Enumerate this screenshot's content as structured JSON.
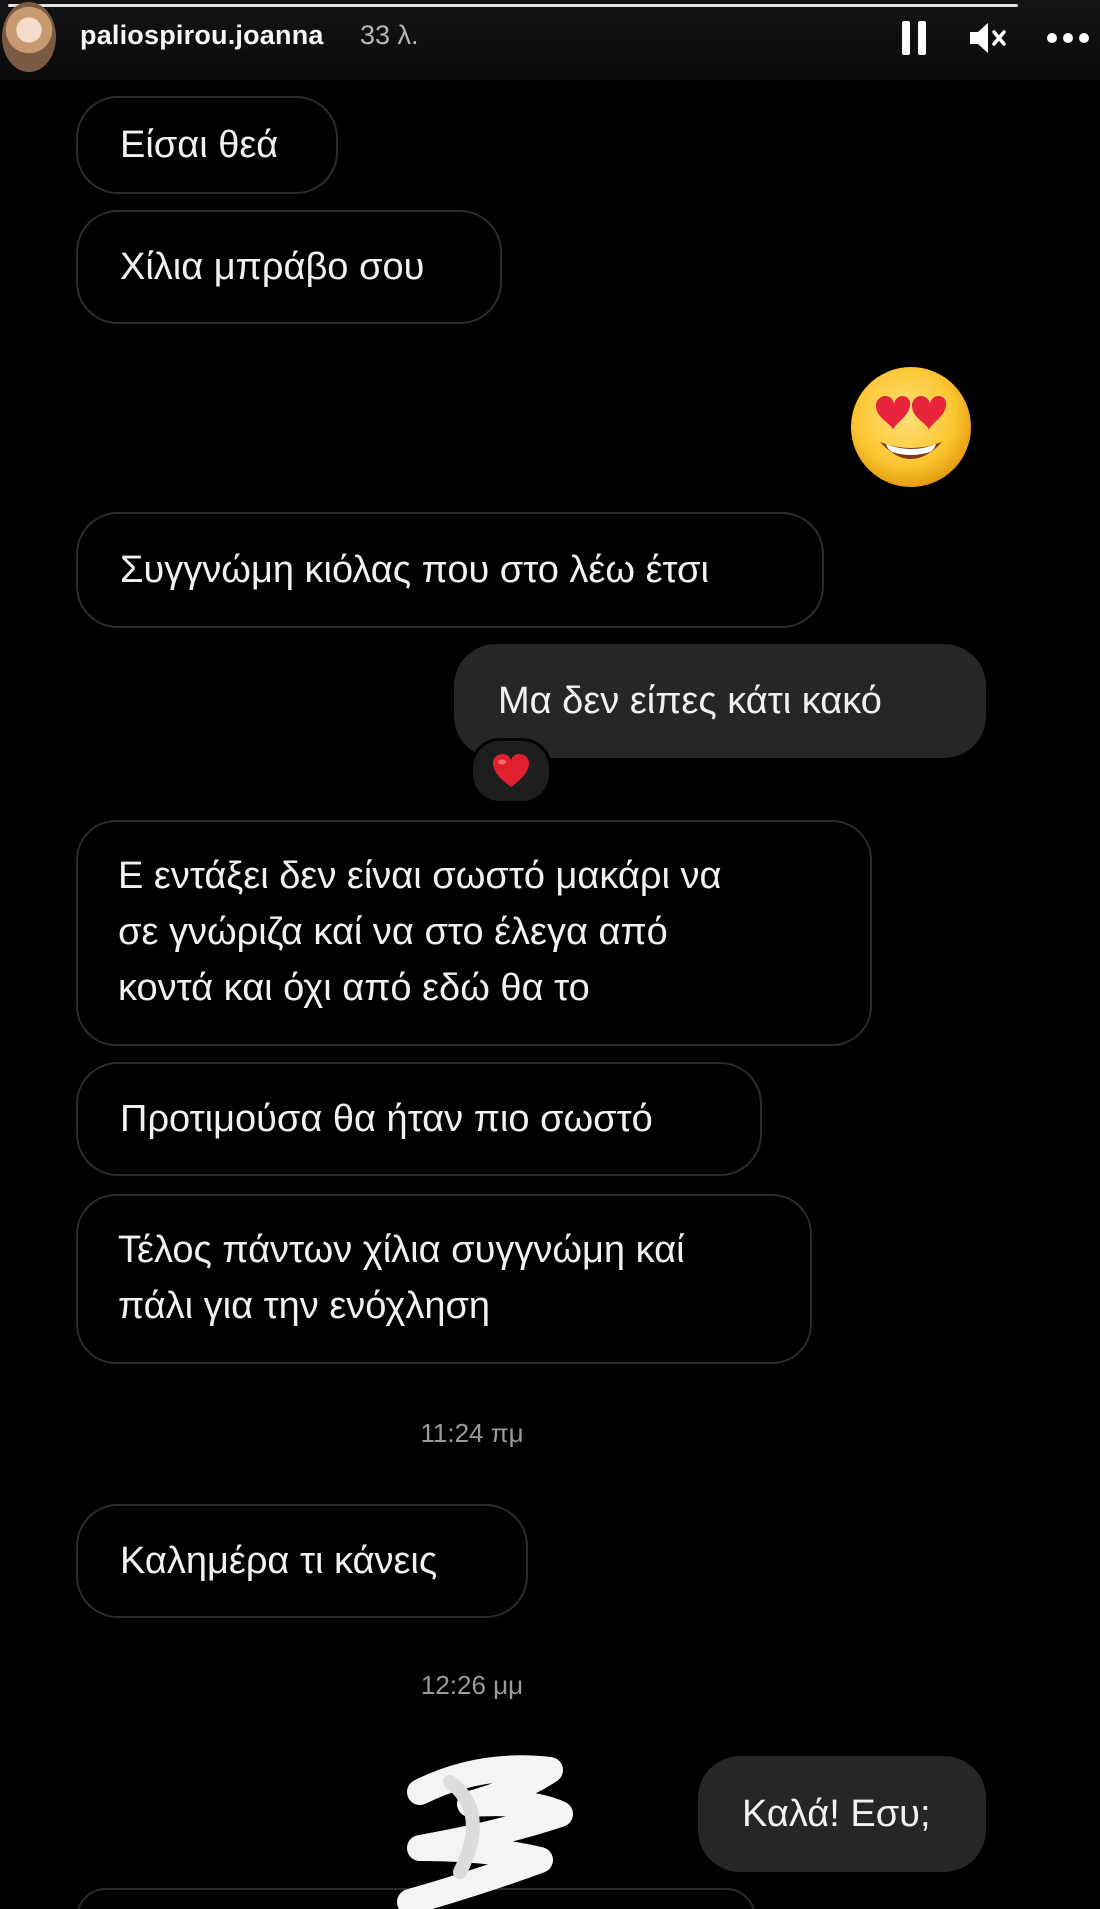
{
  "header": {
    "username": "paliospirou.joanna",
    "time_ago": "33 λ.",
    "avatar_icon": "profile-avatar",
    "pause_icon": "pause-icon",
    "mute_icon": "speaker-muted-icon",
    "more_icon": "more-dots-icon",
    "progress": 1.0
  },
  "messages": [
    {
      "side": "incoming",
      "text": "Είσαι θεά"
    },
    {
      "side": "incoming",
      "text": "Χίλια μπράβο σου"
    },
    {
      "side": "outgoing",
      "emoji": "heart-eyes-emoji"
    },
    {
      "side": "incoming",
      "text": "Συγγνώμη κιόλας που στο λέω έτσι"
    },
    {
      "side": "outgoing",
      "text": "Μα δεν είπες κάτι κακό",
      "reaction": "red-heart-emoji"
    },
    {
      "side": "incoming",
      "lines": [
        "Ε  εντάξει δεν είναι σωστό μακάρι να",
        "σε γνώριζα καί να στο έλεγα από",
        "κοντά και όχι από εδώ θα το"
      ]
    },
    {
      "side": "incoming",
      "text": "Προτιμούσα θα ήταν πιο σωστό"
    },
    {
      "side": "incoming",
      "lines": [
        "Τέλος πάντων χίλια συγγνώμη καί",
        "πάλι για την ενόχληση"
      ]
    },
    {
      "timestamp": "11:24 πμ"
    },
    {
      "side": "incoming",
      "text": "Καλημέρα τι κάνεις"
    },
    {
      "timestamp": "12:26 μμ"
    },
    {
      "side": "outgoing",
      "text": "Καλά! Εσυ;",
      "overlay": "white-scribble-sticker"
    }
  ],
  "colors": {
    "background": "#000000",
    "incoming_border": "#2b2b2b",
    "outgoing_fill": "#262626",
    "text": "#f1f1f1",
    "timestamp": "#9a9a9a"
  }
}
